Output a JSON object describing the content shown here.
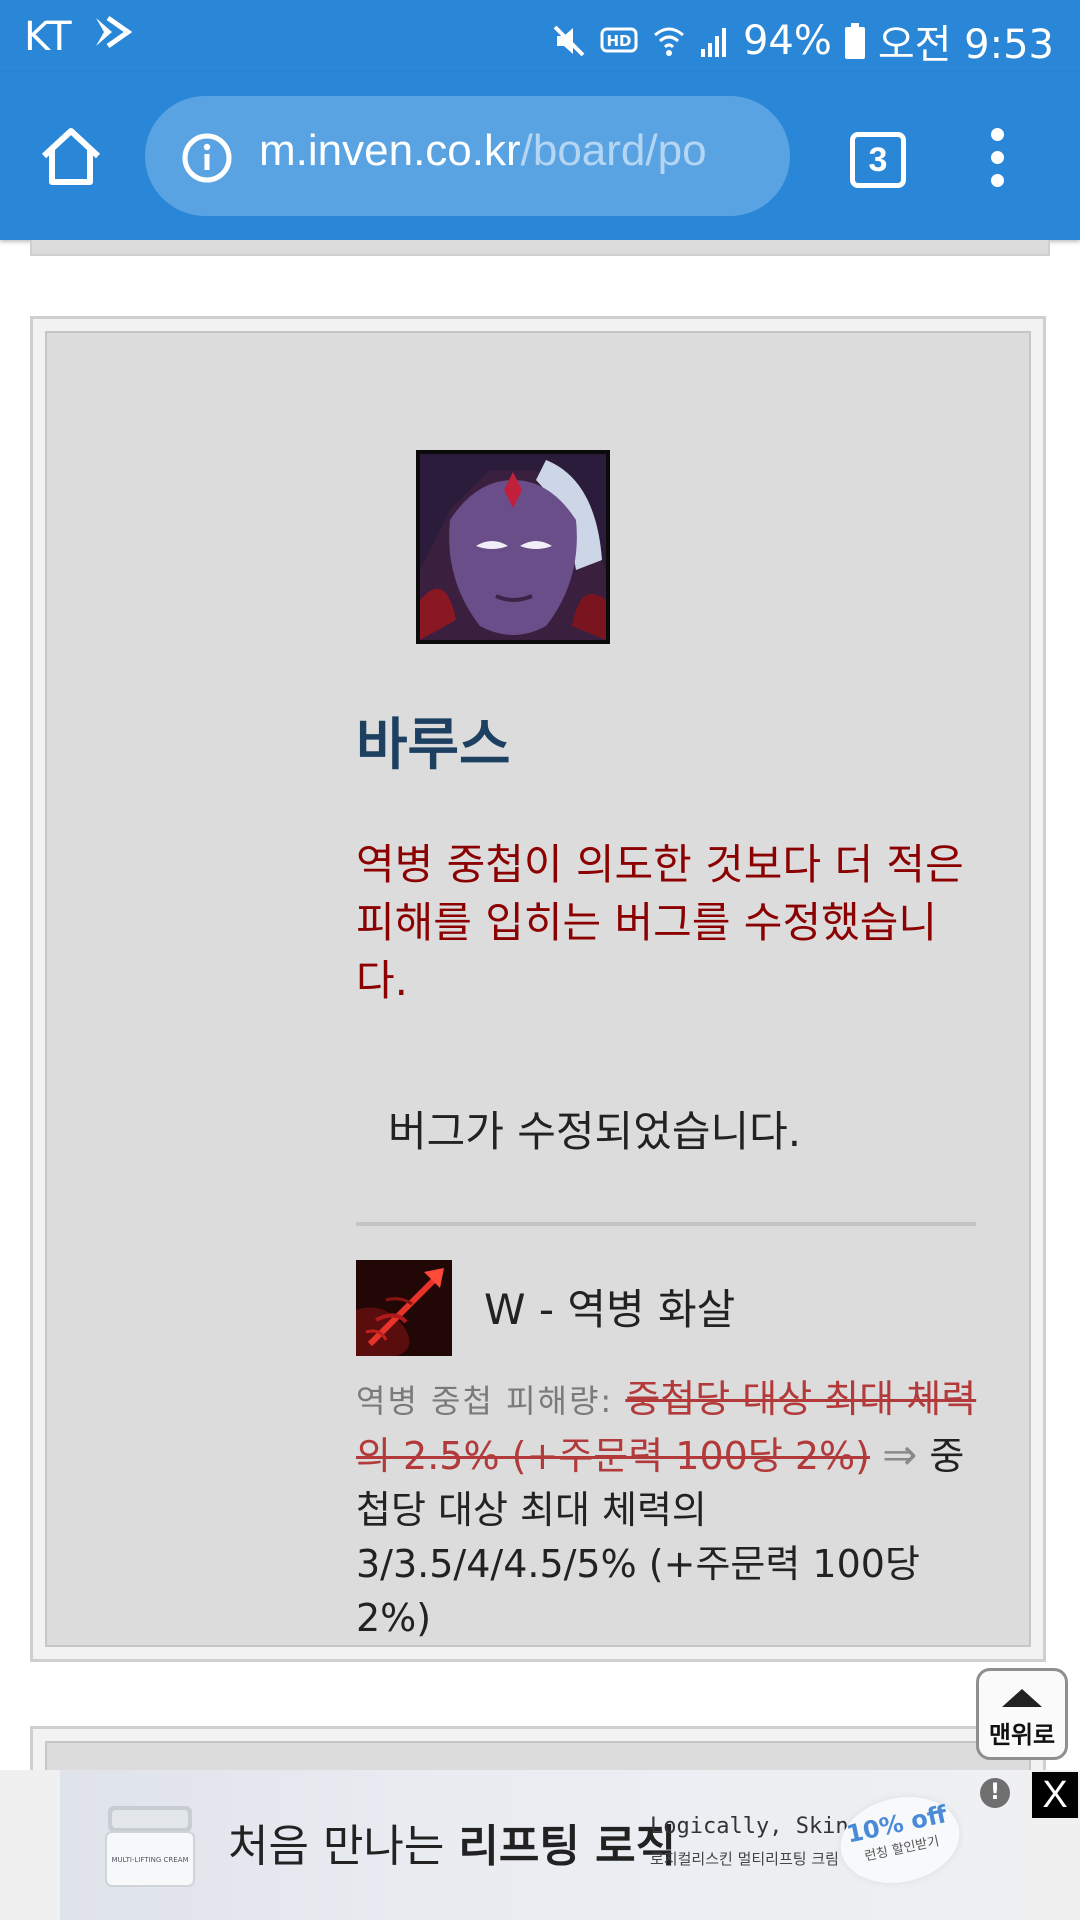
{
  "status_bar": {
    "carrier": "KT",
    "battery": "94%",
    "time": "오전 9:53"
  },
  "browser": {
    "url_host": "m.inven.co.kr",
    "url_path": "/board/po",
    "tab_count": "3"
  },
  "post": {
    "champion_name": "바루스",
    "change_description": "역병 중첩이 의도한 것보다 더 적은 피해를 입히는 버그를 수정했습니다.",
    "context_note": "버그가 수정되었습니다.",
    "ability_name": "W - 역병 화살",
    "stat_label": "역병 중첩 피해량:",
    "old_value": "중첩당 대상 최대 체력의 2.5% (+주문력 100당 2%)",
    "arrow": "⇒",
    "new_value": "중첩당 대상 최대 체력의 3/3.5/4/4.5/5% (+주문력 100당 2%)"
  },
  "back_to_top_label": "맨위로",
  "ad": {
    "headline_normal": "처음 만나는 ",
    "headline_bold": "리프팅 로직",
    "tagline": "Logically, Skin",
    "subline": "로지컬리스킨 멀티리프팅 크림",
    "coupon_pct": "10% off",
    "coupon_cta": "런칭 할인받기",
    "jar_label": "MULTI-LIFTING CREAM",
    "info_label": "!",
    "close_label": "X"
  }
}
